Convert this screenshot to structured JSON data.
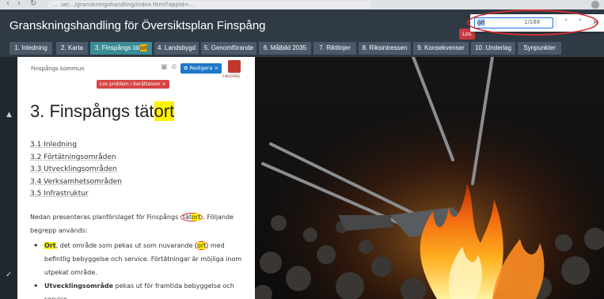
{
  "browser": {
    "back": "‹",
    "forward": "›",
    "reload": "↻",
    "url": "... .se/.../granskningshandling/index.html?appid=..."
  },
  "app": {
    "title": "Granskningshandling för Översiktsplan Finspång",
    "los_label": "Los"
  },
  "find": {
    "query": "ort",
    "count": "1/188",
    "prev": "˄",
    "next": "˅",
    "close": "✕"
  },
  "tabs": [
    {
      "label": "1. Inledning"
    },
    {
      "label": "2. Karta"
    },
    {
      "label_pre": "3. Finspångs tät",
      "label_hl": "ort"
    },
    {
      "label": "4. Landsbygd"
    },
    {
      "label": "5. Genomförande"
    },
    {
      "label": "6. Målbild 2035"
    },
    {
      "label": "7. Riktlinjer"
    },
    {
      "label": "8. Riksintressen"
    },
    {
      "label": "9. Konsekvenser"
    },
    {
      "label": "10. Underlag"
    },
    {
      "label": "Synpunkter"
    }
  ],
  "panel": {
    "kommun": "Finspångs kommun",
    "edit_label": "✿ Redigera ×",
    "logo_text": "FINSPÅNG",
    "problem_label": "Los problem i berättelsen ×",
    "heading_pre": "3. Finspångs tät",
    "heading_hl": "ort",
    "toc": [
      "3.1 Inledning",
      "3.2 Förtätningsområden",
      "3.3 Utvecklingsområden",
      "3.4 Verksamhetsområden",
      "3.5 Infrastruktur"
    ],
    "intro_a": "Nedan presenteras planförslaget för Finspångs ",
    "intro_ring_pre": "tät",
    "intro_ring_hl": "ort",
    "intro_b": ". Följande begrepp används:",
    "b1_bold": "Ort",
    "b1_a": ", det område som pekas ut som nuvarande ",
    "b1_ring": "ort",
    "b1_b": " med befintlig bebyggelse och service. Förtätningar är möjliga inom utpekat område.",
    "b2_bold": "Utvecklingsområde",
    "b2_rest": " pekas ut för framtida bebyggelse och service."
  },
  "colors": {
    "appbar": "#2f3a45",
    "tab": "#4b5968",
    "tab_active": "#3a8d95",
    "highlight": "#fff200",
    "annotation": "#d32f2f",
    "edit_button": "#1f78c8",
    "problem_button": "#d64545"
  }
}
